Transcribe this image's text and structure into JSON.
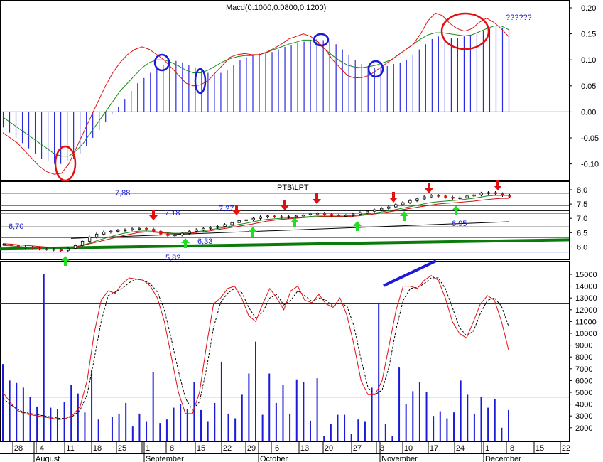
{
  "chart_data": [
    {
      "type": "bar",
      "panel": "macd",
      "title": "Macd(0.1000,0.0800,0.1200)",
      "ylim": [
        -0.13,
        0.21
      ],
      "yticks": [
        "0.20",
        "0.15",
        "0.10",
        "0.05",
        "0.00",
        "-0.05",
        "-0.10"
      ],
      "annotation": "??????",
      "histogram": [
        -0.03,
        -0.04,
        -0.05,
        -0.06,
        -0.07,
        -0.08,
        -0.09,
        -0.095,
        -0.1,
        -0.1,
        -0.095,
        -0.09,
        -0.08,
        -0.065,
        -0.05,
        -0.035,
        -0.02,
        -0.005,
        0.01,
        0.025,
        0.04,
        0.055,
        0.065,
        0.075,
        0.085,
        0.09,
        0.095,
        0.098,
        0.095,
        0.09,
        0.085,
        0.08,
        0.075,
        0.072,
        0.075,
        0.08,
        0.09,
        0.1,
        0.105,
        0.11,
        0.112,
        0.112,
        0.115,
        0.12,
        0.125,
        0.128,
        0.132,
        0.135,
        0.138,
        0.14,
        0.138,
        0.135,
        0.13,
        0.12,
        0.11,
        0.1,
        0.092,
        0.088,
        0.085,
        0.085,
        0.088,
        0.092,
        0.095,
        0.1,
        0.11,
        0.12,
        0.13,
        0.14,
        0.145,
        0.145,
        0.142,
        0.142,
        0.145,
        0.148,
        0.15,
        0.155,
        0.16,
        0.163,
        0.162,
        0.16
      ],
      "series": [
        {
          "color": "#e01010",
          "values": [
            -0.04,
            -0.05,
            -0.06,
            -0.075,
            -0.09,
            -0.105,
            -0.115,
            -0.12,
            -0.118,
            -0.1,
            -0.07,
            -0.04,
            -0.01,
            0.02,
            0.05,
            0.075,
            0.095,
            0.11,
            0.12,
            0.125,
            0.12,
            0.11,
            0.1,
            0.085,
            0.07,
            0.055,
            0.05,
            0.052,
            0.06,
            0.075,
            0.09,
            0.105,
            0.11,
            0.112,
            0.11,
            0.11,
            0.115,
            0.122,
            0.13,
            0.14,
            0.145,
            0.15,
            0.145,
            0.135,
            0.12,
            0.1,
            0.085,
            0.07,
            0.065,
            0.066,
            0.07,
            0.08,
            0.09,
            0.1,
            0.11,
            0.12,
            0.13,
            0.15,
            0.175,
            0.19,
            0.185,
            0.17,
            0.16,
            0.155,
            0.16,
            0.172,
            0.18,
            0.172,
            0.16,
            0.145
          ]
        },
        {
          "color": "#1a8a1a",
          "values": [
            -0.01,
            -0.02,
            -0.03,
            -0.04,
            -0.05,
            -0.06,
            -0.07,
            -0.08,
            -0.085,
            -0.085,
            -0.075,
            -0.06,
            -0.04,
            -0.02,
            0.0,
            0.02,
            0.04,
            0.055,
            0.07,
            0.085,
            0.095,
            0.1,
            0.1,
            0.095,
            0.088,
            0.08,
            0.075,
            0.075,
            0.08,
            0.088,
            0.096,
            0.102,
            0.106,
            0.108,
            0.108,
            0.11,
            0.114,
            0.12,
            0.125,
            0.13,
            0.134,
            0.138,
            0.138,
            0.132,
            0.12,
            0.108,
            0.098,
            0.09,
            0.086,
            0.085,
            0.087,
            0.09,
            0.095,
            0.1,
            0.11,
            0.12,
            0.13,
            0.14,
            0.148,
            0.152,
            0.152,
            0.15,
            0.148,
            0.146,
            0.148,
            0.154,
            0.16,
            0.165,
            0.165,
            0.158
          ]
        }
      ]
    },
    {
      "type": "line",
      "panel": "price",
      "title": "PTB\\LPT",
      "ylim": [
        5.65,
        8.2
      ],
      "yticks": [
        "8.0",
        "7.5",
        "7.0",
        "6.5",
        "6.0"
      ],
      "levels": [
        "7,88",
        "7,18",
        "7,27",
        "6,70",
        "6,33",
        "5,82",
        "6,95"
      ],
      "price": [
        6.1,
        6.05,
        6.0,
        5.98,
        5.95,
        5.93,
        5.92,
        5.9,
        5.88,
        5.95,
        6.05,
        6.2,
        6.35,
        6.45,
        6.52,
        6.55,
        6.58,
        6.6,
        6.63,
        6.65,
        6.62,
        6.55,
        6.45,
        6.4,
        6.42,
        6.48,
        6.55,
        6.6,
        6.65,
        6.68,
        6.72,
        6.78,
        6.85,
        6.92,
        6.95,
        7.0,
        7.05,
        7.08,
        7.06,
        7.04,
        7.06,
        7.08,
        7.12,
        7.15,
        7.18,
        7.14,
        7.1,
        7.08,
        7.1,
        7.15,
        7.2,
        7.25,
        7.3,
        7.35,
        7.4,
        7.48,
        7.55,
        7.62,
        7.68,
        7.75,
        7.8,
        7.78,
        7.74,
        7.7,
        7.72,
        7.78,
        7.82,
        7.88,
        7.9,
        7.86,
        7.8,
        7.75
      ],
      "series": [
        {
          "color": "#1a8a1a",
          "values": [
            6.05,
            6.04,
            6.02,
            6.0,
            5.98,
            5.96,
            5.95,
            5.94,
            5.94,
            5.97,
            6.0,
            6.05,
            6.12,
            6.2,
            6.28,
            6.35,
            6.42,
            6.48,
            6.52,
            6.55,
            6.56,
            6.55,
            6.52,
            6.5,
            6.48,
            6.48,
            6.5,
            6.53,
            6.56,
            6.6,
            6.64,
            6.68,
            6.73,
            6.78,
            6.82,
            6.87,
            6.92,
            6.96,
            6.98,
            7.0,
            7.01,
            7.02,
            7.04,
            7.06,
            7.08,
            7.08,
            7.08,
            7.08,
            7.08,
            7.1,
            7.12,
            7.15,
            7.18,
            7.22,
            7.26,
            7.3,
            7.35,
            7.4,
            7.45,
            7.5,
            7.55,
            7.58,
            7.6,
            7.62,
            7.64,
            7.67,
            7.7,
            7.74,
            7.78,
            7.8,
            7.8,
            7.8
          ]
        },
        {
          "color": "#d01010",
          "values": [
            6.12,
            6.1,
            6.08,
            6.06,
            6.04,
            6.02,
            6.0,
            5.98,
            5.97,
            5.98,
            6.0,
            6.04,
            6.1,
            6.16,
            6.22,
            6.28,
            6.34,
            6.4,
            6.45,
            6.5,
            6.52,
            6.52,
            6.5,
            6.48,
            6.47,
            6.47,
            6.48,
            6.5,
            6.53,
            6.56,
            6.6,
            6.64,
            6.68,
            6.72,
            6.76,
            6.8,
            6.85,
            6.9,
            6.93,
            6.96,
            6.98,
            7.0,
            7.02,
            7.04,
            7.05,
            7.06,
            7.06,
            7.06,
            7.06,
            7.07,
            7.09,
            7.12,
            7.15,
            7.18,
            7.22,
            7.26,
            7.3,
            7.34,
            7.38,
            7.42,
            7.46,
            7.5,
            7.52,
            7.54,
            7.56,
            7.58,
            7.6,
            7.63,
            7.66,
            7.68,
            7.7,
            7.7
          ]
        }
      ]
    },
    {
      "type": "bar",
      "panel": "stochastic",
      "ylim": [
        0,
        16200
      ],
      "yticks": [
        "15000",
        "14000",
        "13000",
        "12000",
        "11000",
        "10000",
        "9000",
        "8000",
        "7000",
        "6000",
        "5000",
        "4000",
        "3000",
        "2000"
      ],
      "volume": [
        7400,
        6000,
        5800,
        5400,
        4600,
        3800,
        15000,
        3700,
        3600,
        4200,
        5600,
        4900,
        3300,
        6900,
        2700,
        900,
        2900,
        3200,
        4100,
        2100,
        3200,
        2500,
        6700,
        2400,
        2700,
        3700,
        4000,
        3600,
        5900,
        3500,
        2500,
        4100,
        7600,
        3200,
        2800,
        4800,
        6600,
        9300,
        3100,
        6600,
        4100,
        5600,
        3200,
        6100,
        5900,
        2600,
        6200,
        1300,
        2300,
        3100,
        3100,
        1500,
        2700,
        2500,
        5400,
        12600,
        2300,
        1300,
        7100,
        4000,
        5100,
        5900,
        5000,
        3000,
        3400,
        2800,
        3300,
        6000,
        4800,
        3200,
        4600,
        3700,
        4400,
        2000,
        3500
      ],
      "series": [
        {
          "color": "#e01010",
          "values": [
            5000,
            4200,
            3500,
            3200,
            3100,
            3000,
            2900,
            2800,
            2700,
            2800,
            3100,
            3800,
            6000,
            10000,
            12800,
            13600,
            13400,
            14200,
            14700,
            14600,
            14500,
            14000,
            13000,
            11000,
            8000,
            5000,
            3200,
            3200,
            5000,
            9000,
            12500,
            13000,
            13800,
            14000,
            13000,
            11500,
            11000,
            12500,
            13800,
            13000,
            12000,
            13600,
            14000,
            12800,
            12600,
            13300,
            12500,
            12200,
            13000,
            11500,
            9000,
            6000,
            4800,
            4800,
            6000,
            9000,
            12000,
            14000,
            14000,
            13800,
            14500,
            14900,
            14500,
            13000,
            11000,
            10000,
            9600,
            11000,
            12500,
            13200,
            12800,
            11000,
            8600
          ]
        },
        {
          "color": "#000000",
          "values": [
            4500,
            4000,
            3600,
            3300,
            3200,
            3100,
            3000,
            2900,
            2800,
            2800,
            3000,
            3500,
            4800,
            7800,
            11000,
            13200,
            13500,
            13800,
            14300,
            14600,
            14500,
            14200,
            13500,
            12000,
            9500,
            6800,
            4500,
            3500,
            4200,
            7000,
            10500,
            12600,
            13400,
            13800,
            13500,
            12200,
            11300,
            11800,
            13000,
            13300,
            12400,
            12800,
            13600,
            13200,
            12700,
            13000,
            12800,
            12300,
            12600,
            12300,
            10600,
            7800,
            5400,
            4800,
            5200,
            7200,
            10400,
            12800,
            13800,
            13900,
            14200,
            14700,
            14700,
            13800,
            12200,
            10500,
            9800,
            10200,
            11700,
            12800,
            13000,
            12300,
            10600
          ]
        }
      ],
      "ref_lines": [
        12500,
        4600
      ]
    }
  ],
  "x_day_labels": [
    "28",
    "4",
    "11",
    "18",
    "25",
    "1",
    "8",
    "15",
    "22",
    "29",
    "6",
    "13",
    "20",
    "27",
    "3",
    "10",
    "17",
    "24",
    "1",
    "8",
    "15",
    "22"
  ],
  "x_month_labels": [
    "August",
    "September",
    "October",
    "November",
    "December"
  ]
}
